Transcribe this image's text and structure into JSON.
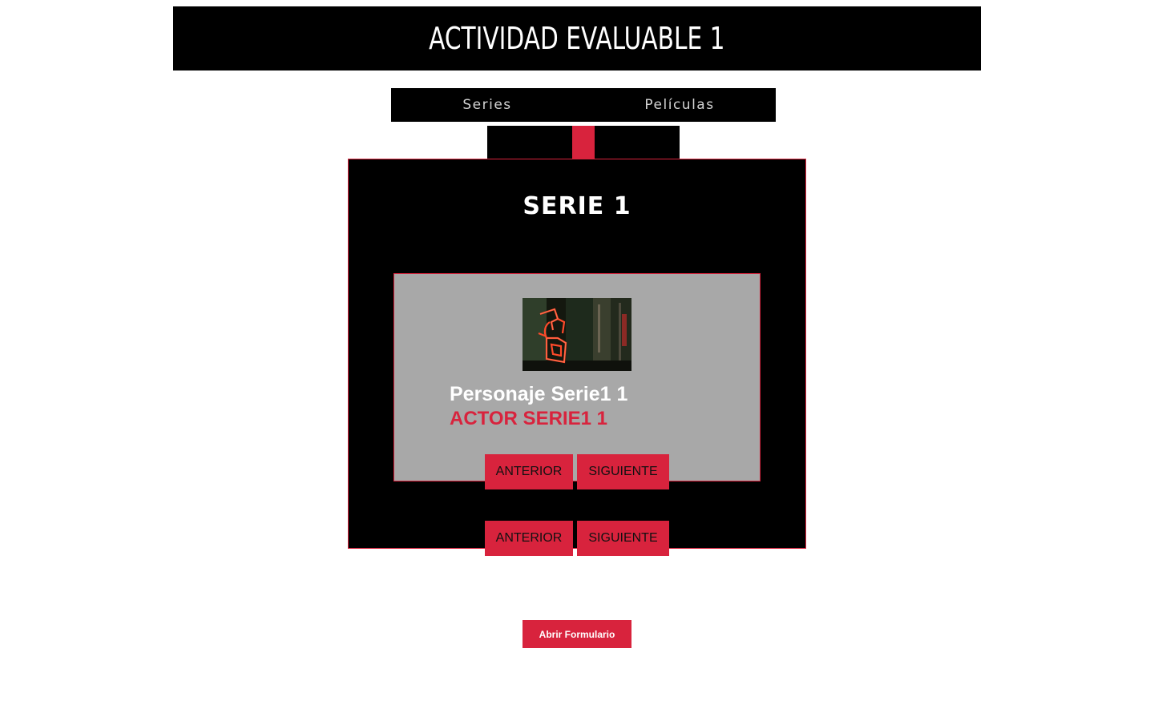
{
  "header": {
    "title": "ACTIVIDAD EVALUABLE 1"
  },
  "nav": {
    "items": [
      {
        "label": "Series"
      },
      {
        "label": "Películas"
      }
    ]
  },
  "series_panel": {
    "title": "SERIE 1",
    "card": {
      "image_icon": "neon-sign-image",
      "character": "Personaje Serie1 1",
      "actor": "ACTOR SERIE1 1",
      "prev_label": "ANTERIOR",
      "next_label": "SIGUIENTE"
    },
    "prev_label": "ANTERIOR",
    "next_label": "SIGUIENTE"
  },
  "form_button": {
    "label": "Abrir Formulario"
  },
  "colors": {
    "accent": "#d8233d",
    "panel": "#000000",
    "card": "#a8a8a8"
  }
}
